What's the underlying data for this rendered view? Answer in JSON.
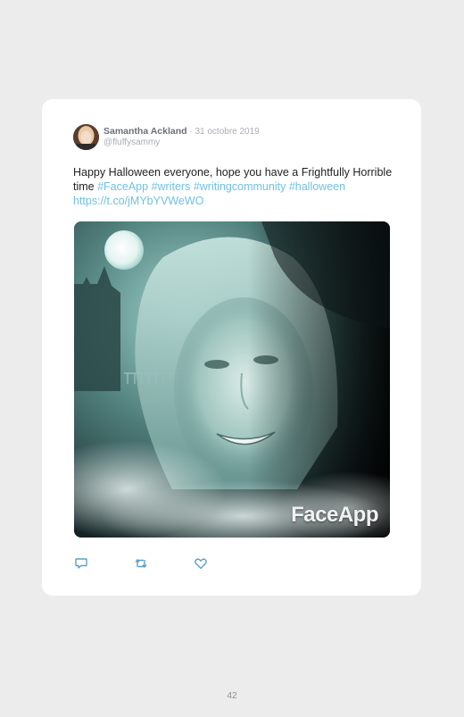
{
  "tweet": {
    "display_name": "Samantha Ackland",
    "separator": " · ",
    "date": "31 octobre 2019",
    "handle": "@fluffysammy",
    "text_plain_1": "Happy Halloween everyone, hope you have a Frightfully Horrible time ",
    "hashtag_1": "#FaceApp",
    "hashtag_2": "#writers",
    "hashtag_3": "#writingcommunity",
    "hashtag_4": "#halloween",
    "url": "https://t.co/jMYbYVWeWO",
    "image_watermark": "FaceApp",
    "link_color": "#6fc1e6"
  },
  "actions": [
    {
      "name": "reply",
      "icon": "reply-icon"
    },
    {
      "name": "retweet",
      "icon": "retweet-icon"
    },
    {
      "name": "like",
      "icon": "heart-icon"
    }
  ],
  "footer": {
    "page_number": "42"
  }
}
